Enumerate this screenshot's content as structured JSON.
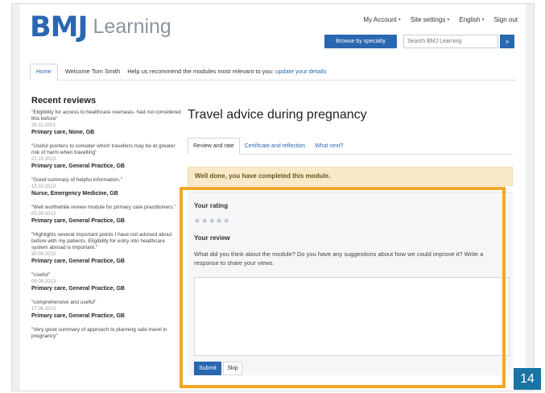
{
  "header": {
    "logo_mark": "BMJ",
    "logo_word": "Learning",
    "links": [
      "My Account",
      "Site settings",
      "English",
      "Sign out"
    ],
    "browse_label": "Browse by specialty",
    "search_placeholder": "Search BMJ Learning",
    "search_button": "»"
  },
  "nav": {
    "home": "Home",
    "welcome": "Welcome Tom Smith",
    "help_text": "Help us recommend the modules most relevant to you:",
    "help_link": "update your details"
  },
  "sidebar": {
    "title": "Recent reviews",
    "reviews": [
      {
        "quote": "\"Eligibility for access to healthcare overseas- had not considered this before\"",
        "date": "28.11.2013",
        "author": "Primary care, None, GB"
      },
      {
        "quote": "\"Useful pointers to consider which travellers may be at greater risk of harm when travelling\"",
        "date": "21.10.2013",
        "author": "Primary care, General Practice, GB"
      },
      {
        "quote": "\"Good summary of helpful information.\"",
        "date": "13.10.2013",
        "author": "Nurse, Emergency Medicine, GB"
      },
      {
        "quote": "\"Well worthwhile review module for primary care practitioners.\"",
        "date": "05.09.2013",
        "author": "Primary care, General Practice, GB"
      },
      {
        "quote": "\"Highlights several important points I have not advised about before with my patients. Eligibility for entry into healthcare system abroad is important.\"",
        "date": "30.08.2013",
        "author": "Primary care, General Practice, GB"
      },
      {
        "quote": "\"Useful\"",
        "date": "09.08.2013",
        "author": "Primary care, General Practice, GB"
      },
      {
        "quote": "\"comprehensive and useful\"",
        "date": "17.06.2013",
        "author": "Primary care, General Practice, GB"
      },
      {
        "quote": "\"Very good summary of approach to planning safe travel in pregnancy\"",
        "date": "",
        "author": ""
      }
    ]
  },
  "main": {
    "title": "Travel advice during pregnancy",
    "tabs": [
      "Review and rate",
      "Certificate and reflection",
      "What next?"
    ],
    "banner": "Well done, you have completed this module.",
    "rating_label": "Your rating",
    "stars": "★★★★★",
    "review_label": "Your review",
    "review_description": "What did you think about the module? Do you have any suggestions about how we could improve it? Write a response to share your views.",
    "submit": "Submit",
    "skip": "Skip"
  },
  "annotation": {
    "step": "14",
    "highlight_color": "#f3a627",
    "badge_color": "#1a74a3"
  },
  "colors": {
    "brand_blue": "#2a67b1",
    "banner_bg": "#f8e9c9"
  }
}
